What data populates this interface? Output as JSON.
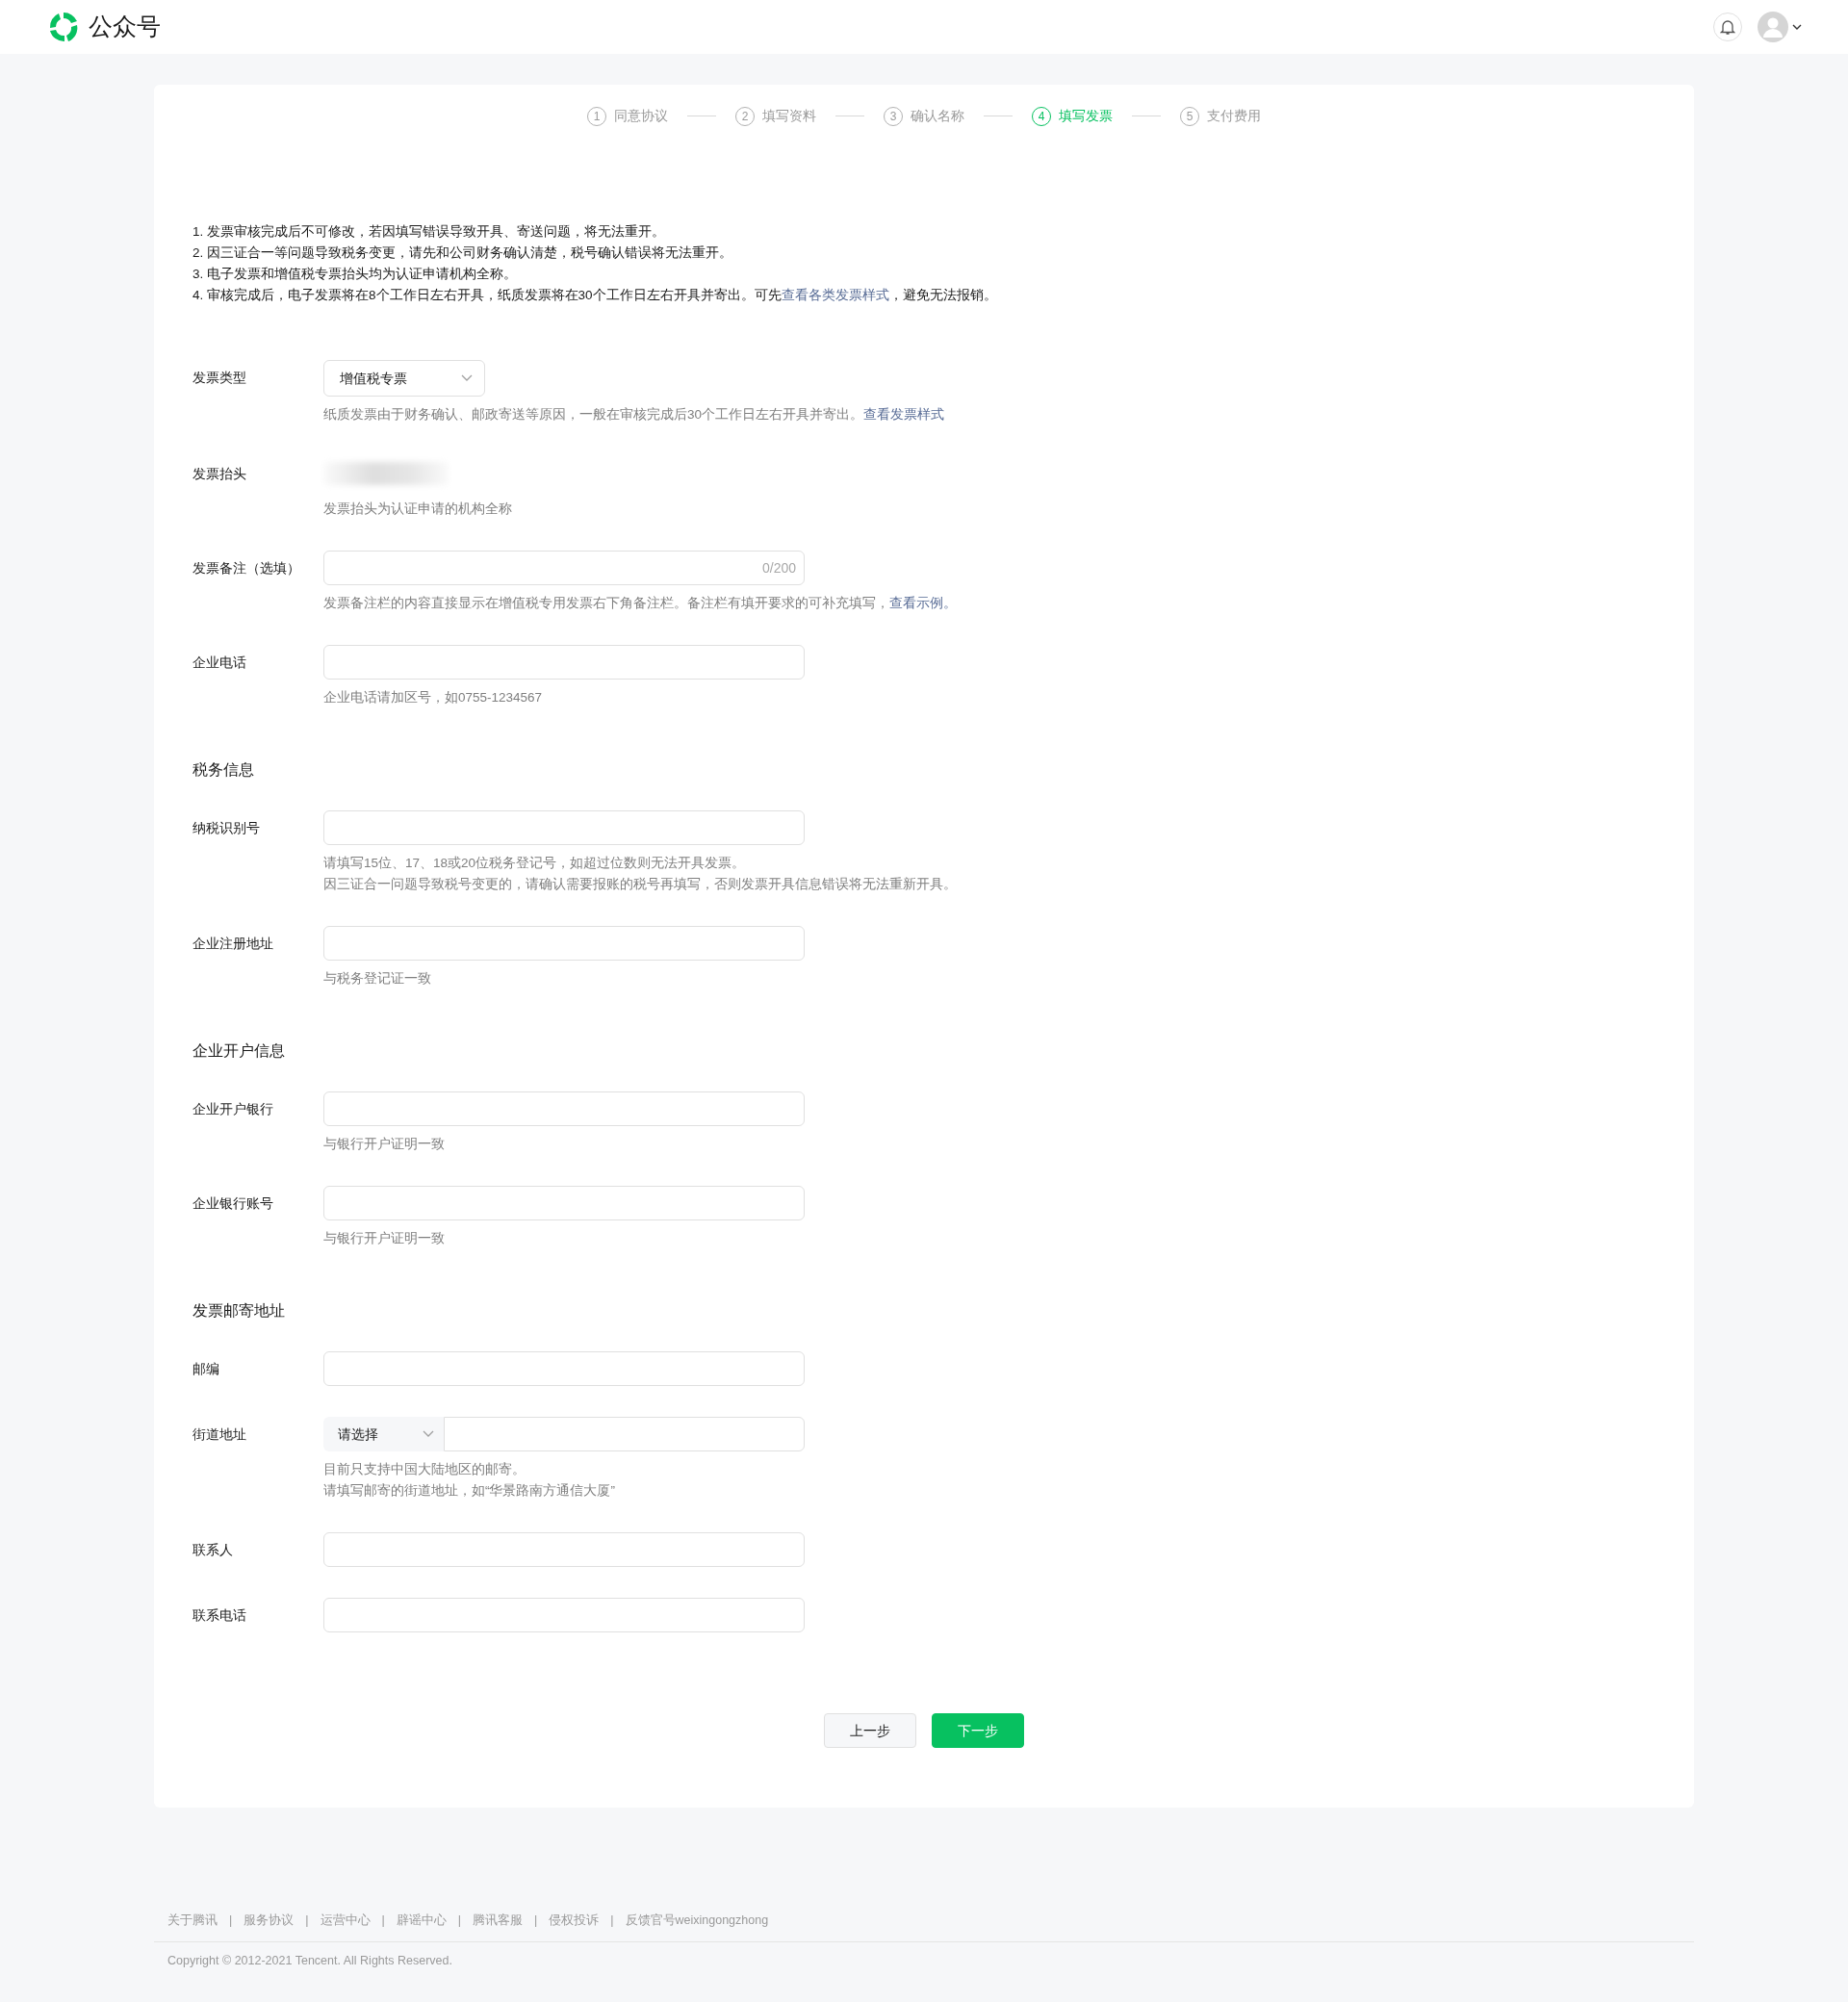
{
  "header": {
    "logo_text": "公众号"
  },
  "steps": [
    {
      "number": "1",
      "label": "同意协议",
      "selected": false
    },
    {
      "number": "2",
      "label": "填写资料",
      "selected": false
    },
    {
      "number": "3",
      "label": "确认名称",
      "selected": false
    },
    {
      "number": "4",
      "label": "填写发票",
      "selected": true
    },
    {
      "number": "5",
      "label": "支付费用",
      "selected": false
    }
  ],
  "notices": [
    {
      "text": "1. 发票审核完成后不可修改，若因填写错误导致开具、寄送问题，将无法重开。"
    },
    {
      "text": "2. 因三证合一等问题导致税务变更，请先和公司财务确认清楚，税号确认错误将无法重开。"
    },
    {
      "text": "3. 电子发票和增值税专票抬头均为认证申请机构全称。"
    },
    {
      "text": "4. 审核完成后，电子发票将在8个工作日左右开具，纸质发票将在30个工作日左右开具并寄出。可先",
      "link": "查看各类发票样式",
      "after": "，避免无法报销。"
    }
  ],
  "sections": [
    {
      "fields": [
        {
          "kind": "select",
          "label": "发票类型",
          "value": "增值税专票",
          "hints": [
            {
              "text": "纸质发票由于财务确认、邮政寄送等原因，一般在审核完成后30个工作日左右开具并寄出。",
              "link": "查看发票样式"
            }
          ]
        },
        {
          "kind": "blurred",
          "label": "发票抬头",
          "hints": [
            {
              "text": "发票抬头为认证申请的机构全称"
            }
          ]
        },
        {
          "kind": "counter",
          "label": "发票备注（选填）",
          "counter": "0/200",
          "hints": [
            {
              "text": "发票备注栏的内容直接显示在增值税专用发票右下角备注栏。备注栏有填开要求的可补充填写，",
              "link": "查看示例。"
            }
          ]
        },
        {
          "kind": "input",
          "label": "企业电话",
          "hints": [
            {
              "text": "企业电话请加区号，如0755-1234567"
            }
          ]
        }
      ]
    },
    {
      "heading": "税务信息",
      "fields": [
        {
          "kind": "input",
          "label": "纳税识别号",
          "hints": [
            {
              "text": "请填写15位、17、18或20位税务登记号，如超过位数则无法开具发票。"
            },
            {
              "text": "因三证合一问题导致税号变更的，请确认需要报账的税号再填写，否则发票开具信息错误将无法重新开具。"
            }
          ]
        },
        {
          "kind": "input",
          "label": "企业注册地址",
          "hints": [
            {
              "text": "与税务登记证一致"
            }
          ]
        }
      ]
    },
    {
      "heading": "企业开户信息",
      "fields": [
        {
          "kind": "input",
          "label": "企业开户银行",
          "hints": [
            {
              "text": "与银行开户证明一致"
            }
          ]
        },
        {
          "kind": "input",
          "label": "企业银行账号",
          "hints": [
            {
              "text": "与银行开户证明一致"
            }
          ]
        }
      ]
    },
    {
      "heading": "发票邮寄地址",
      "fields": [
        {
          "kind": "input",
          "label": "邮编"
        },
        {
          "kind": "address",
          "label": "街道地址",
          "value": "请选择",
          "hints": [
            {
              "text": "目前只支持中国大陆地区的邮寄。"
            },
            {
              "text": "请填写邮寄的街道地址，如“华景路南方通信大厦”"
            }
          ]
        },
        {
          "kind": "input",
          "label": "联系人"
        },
        {
          "kind": "input",
          "label": "联系电话"
        }
      ]
    }
  ],
  "buttons": [
    {
      "label": "上一步",
      "primary": false
    },
    {
      "label": "下一步",
      "primary": true
    }
  ],
  "footer": {
    "separator": "|",
    "links": [
      "关于腾讯",
      "服务协议",
      "运营中心",
      "辟谣中心",
      "腾讯客服",
      "侵权投诉",
      "反馈官号weixingongzhong"
    ],
    "copyright": "Copyright © 2012-2021 Tencent. All Rights Reserved."
  }
}
